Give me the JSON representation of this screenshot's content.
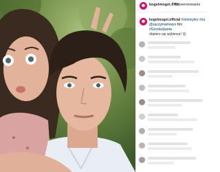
{
  "post": {
    "header": {
      "username": "kogelmogel.offic",
      "separator": "•",
      "follow_label": "Obserwowanie"
    },
    "caption": {
      "username": "kogelmogel.official",
      "hashtag_1": "#zielonytez #za",
      "mention": "@zaczymamswoi",
      "film_word": "film",
      "hashtag_2": "#GorzkaSweta",
      "line_3": "dopiero się wybierze!",
      "emoji": "😊"
    },
    "comments": [
      {
        "avatar_color": "#b3b3b3"
      },
      {
        "avatar_color": "#c7c7c7"
      },
      {
        "avatar_color": "#a48a85"
      },
      {
        "avatar_color": "#bdbdbd"
      },
      {
        "avatar_color": "#9c8b86"
      },
      {
        "avatar_color": "#cfcfcf"
      },
      {
        "avatar_color": "#b0b0b0"
      },
      {
        "avatar_color": "#c4b2ae"
      },
      {
        "avatar_color": "#9f9f9f"
      }
    ]
  },
  "colors": {
    "brand_avatar": "#d1126f",
    "hashtag_link": "#003569",
    "text": "#262626"
  },
  "icons": {
    "post_image": "selfie-photo"
  }
}
